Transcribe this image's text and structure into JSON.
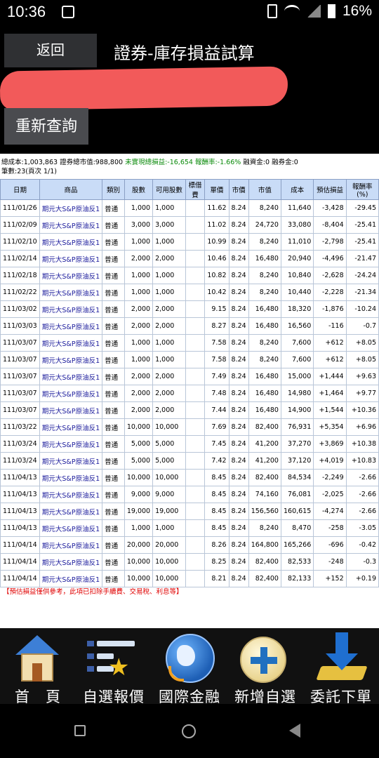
{
  "status": {
    "time": "10:36",
    "battery": "16%"
  },
  "header": {
    "back_label": "返回",
    "title": "證券-庫存損益試算",
    "requery_label": "重新查詢"
  },
  "summary": {
    "line1_a": "總成本:1,003,863 證券總市值:988,800 ",
    "line1_b": "未實現總損益:-16,654 報酬率:-1.66%",
    "line1_c": " 融資金:0 融券金:0",
    "line2": "筆數:23(頁次 1/1)"
  },
  "table": {
    "headers": [
      "日期",
      "商品",
      "類別",
      "股數",
      "可用股數",
      "標借費",
      "單價",
      "市價",
      "市值",
      "成本",
      "預估損益",
      "報酬率(%)"
    ],
    "rows": [
      [
        "111/01/26",
        "期元大S&P原油反1",
        "普通",
        "1,000",
        "1,000",
        "",
        "11.62",
        "8.24",
        "8,240",
        "11,640",
        "-3,428",
        "-29.45"
      ],
      [
        "111/02/09",
        "期元大S&P原油反1",
        "普通",
        "3,000",
        "3,000",
        "",
        "11.02",
        "8.24",
        "24,720",
        "33,080",
        "-8,404",
        "-25.41"
      ],
      [
        "111/02/10",
        "期元大S&P原油反1",
        "普通",
        "1,000",
        "1,000",
        "",
        "10.99",
        "8.24",
        "8,240",
        "11,010",
        "-2,798",
        "-25.41"
      ],
      [
        "111/02/14",
        "期元大S&P原油反1",
        "普通",
        "2,000",
        "2,000",
        "",
        "10.46",
        "8.24",
        "16,480",
        "20,940",
        "-4,496",
        "-21.47"
      ],
      [
        "111/02/18",
        "期元大S&P原油反1",
        "普通",
        "1,000",
        "1,000",
        "",
        "10.82",
        "8.24",
        "8,240",
        "10,840",
        "-2,628",
        "-24.24"
      ],
      [
        "111/02/22",
        "期元大S&P原油反1",
        "普通",
        "1,000",
        "1,000",
        "",
        "10.42",
        "8.24",
        "8,240",
        "10,440",
        "-2,228",
        "-21.34"
      ],
      [
        "111/03/02",
        "期元大S&P原油反1",
        "普通",
        "2,000",
        "2,000",
        "",
        "9.15",
        "8.24",
        "16,480",
        "18,320",
        "-1,876",
        "-10.24"
      ],
      [
        "111/03/03",
        "期元大S&P原油反1",
        "普通",
        "2,000",
        "2,000",
        "",
        "8.27",
        "8.24",
        "16,480",
        "16,560",
        "-116",
        "-0.7"
      ],
      [
        "111/03/07",
        "期元大S&P原油反1",
        "普通",
        "1,000",
        "1,000",
        "",
        "7.58",
        "8.24",
        "8,240",
        "7,600",
        "+612",
        "+8.05"
      ],
      [
        "111/03/07",
        "期元大S&P原油反1",
        "普通",
        "1,000",
        "1,000",
        "",
        "7.58",
        "8.24",
        "8,240",
        "7,600",
        "+612",
        "+8.05"
      ],
      [
        "111/03/07",
        "期元大S&P原油反1",
        "普通",
        "2,000",
        "2,000",
        "",
        "7.49",
        "8.24",
        "16,480",
        "15,000",
        "+1,444",
        "+9.63"
      ],
      [
        "111/03/07",
        "期元大S&P原油反1",
        "普通",
        "2,000",
        "2,000",
        "",
        "7.48",
        "8.24",
        "16,480",
        "14,980",
        "+1,464",
        "+9.77"
      ],
      [
        "111/03/07",
        "期元大S&P原油反1",
        "普通",
        "2,000",
        "2,000",
        "",
        "7.44",
        "8.24",
        "16,480",
        "14,900",
        "+1,544",
        "+10.36"
      ],
      [
        "111/03/22",
        "期元大S&P原油反1",
        "普通",
        "10,000",
        "10,000",
        "",
        "7.69",
        "8.24",
        "82,400",
        "76,931",
        "+5,354",
        "+6.96"
      ],
      [
        "111/03/24",
        "期元大S&P原油反1",
        "普通",
        "5,000",
        "5,000",
        "",
        "7.45",
        "8.24",
        "41,200",
        "37,270",
        "+3,869",
        "+10.38"
      ],
      [
        "111/03/24",
        "期元大S&P原油反1",
        "普通",
        "5,000",
        "5,000",
        "",
        "7.42",
        "8.24",
        "41,200",
        "37,120",
        "+4,019",
        "+10.83"
      ],
      [
        "111/04/13",
        "期元大S&P原油反1",
        "普通",
        "10,000",
        "10,000",
        "",
        "8.45",
        "8.24",
        "82,400",
        "84,534",
        "-2,249",
        "-2.66"
      ],
      [
        "111/04/13",
        "期元大S&P原油反1",
        "普通",
        "9,000",
        "9,000",
        "",
        "8.45",
        "8.24",
        "74,160",
        "76,081",
        "-2,025",
        "-2.66"
      ],
      [
        "111/04/13",
        "期元大S&P原油反1",
        "普通",
        "19,000",
        "19,000",
        "",
        "8.45",
        "8.24",
        "156,560",
        "160,615",
        "-4,274",
        "-2.66"
      ],
      [
        "111/04/13",
        "期元大S&P原油反1",
        "普通",
        "1,000",
        "1,000",
        "",
        "8.45",
        "8.24",
        "8,240",
        "8,470",
        "-258",
        "-3.05"
      ],
      [
        "111/04/14",
        "期元大S&P原油反1",
        "普通",
        "20,000",
        "20,000",
        "",
        "8.26",
        "8.24",
        "164,800",
        "165,266",
        "-696",
        "-0.42"
      ],
      [
        "111/04/14",
        "期元大S&P原油反1",
        "普通",
        "10,000",
        "10,000",
        "",
        "8.25",
        "8.24",
        "82,400",
        "82,533",
        "-248",
        "-0.3"
      ],
      [
        "111/04/14",
        "期元大S&P原油反1",
        "普通",
        "10,000",
        "10,000",
        "",
        "8.21",
        "8.24",
        "82,400",
        "82,133",
        "+152",
        "+0.19"
      ]
    ]
  },
  "note": "【預估損益僅供參考，此項已扣除手續費、交易稅、利息等】",
  "bottom_nav": [
    {
      "label": "首　頁",
      "icon": "home-icon"
    },
    {
      "label": "自選報價",
      "icon": "watchlist-icon"
    },
    {
      "label": "國際金融",
      "icon": "globe-icon"
    },
    {
      "label": "新增自選",
      "icon": "add-icon"
    },
    {
      "label": "委託下單",
      "icon": "order-icon"
    }
  ],
  "colors": {
    "header_bg": "#c9dcf7",
    "loss": "#0c8a0c",
    "gain": "#e00000",
    "product": "#1c1c9c"
  }
}
